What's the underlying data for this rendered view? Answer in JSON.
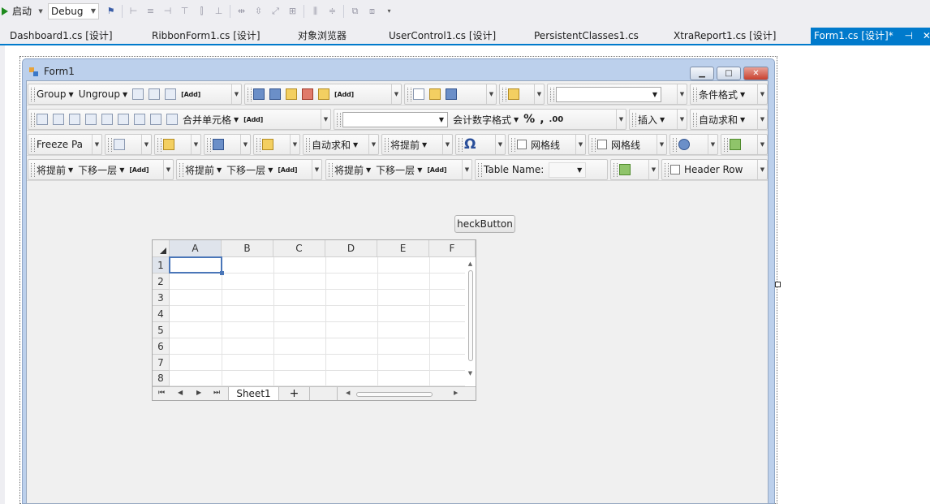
{
  "ide": {
    "start_label": "启动",
    "config": "Debug"
  },
  "tabs": [
    {
      "label": "Dashboard1.cs [设计]"
    },
    {
      "label": "RibbonForm1.cs [设计]"
    },
    {
      "label": "对象浏览器"
    },
    {
      "label": "UserControl1.cs [设计]"
    },
    {
      "label": "PersistentClasses1.cs"
    },
    {
      "label": "XtraReport1.cs [设计]"
    },
    {
      "label": "Form1.cs [设计]*",
      "active": true
    }
  ],
  "tab_pin_glyph": "⊣",
  "tab_close_glyph": "✕",
  "form": {
    "title": "Form1",
    "minimize_glyph": "▁",
    "maximize_glyph": "□",
    "close_glyph": "✕"
  },
  "ribbon": {
    "row1": {
      "group": "Group",
      "ungroup": "Ungroup",
      "add1": "[Add]",
      "add2": "[Add]",
      "conditional": "条件格式"
    },
    "row2": {
      "merge": "合并单元格",
      "add": "[Add]",
      "accounting": "会计数字格式",
      "percent": "%",
      "comma": ",",
      "decimal": ".00",
      "insert": "插入",
      "autosum": "自动求和"
    },
    "row3": {
      "freeze": "Freeze Pa",
      "autosum": "自动求和",
      "bring_forward": "将提前",
      "omega": "Ω",
      "gridlines1": "网格线",
      "gridlines2": "网格线"
    },
    "row4": {
      "bring_forward": "将提前",
      "send_backward": "下移一层",
      "add": "[Add]",
      "table_name": "Table Name:",
      "header_row": "Header Row"
    }
  },
  "check_button": {
    "label": "heckButton"
  },
  "sheet": {
    "columns": [
      "A",
      "B",
      "C",
      "D",
      "E",
      "F"
    ],
    "rows": [
      "1",
      "2",
      "3",
      "4",
      "5",
      "6",
      "7",
      "8"
    ],
    "sheet_tab": "Sheet1",
    "add_sheet": "+"
  }
}
